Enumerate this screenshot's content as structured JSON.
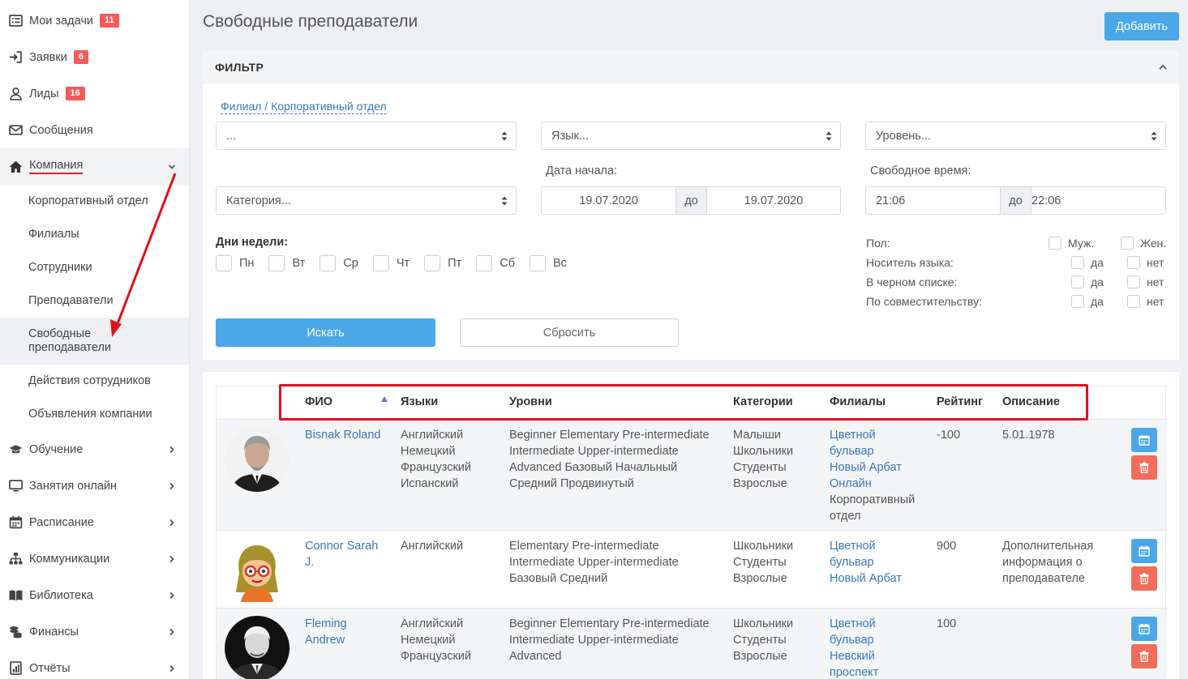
{
  "sidebar": {
    "items": [
      {
        "label": "Мои задачи",
        "badge": "11",
        "icon": "list-icon"
      },
      {
        "label": "Заявки",
        "badge": "6",
        "icon": "sign-in-icon"
      },
      {
        "label": "Лиды",
        "badge": "16",
        "icon": "user-icon"
      },
      {
        "label": "Сообщения",
        "badge": "",
        "icon": "envelope-icon"
      },
      {
        "label": "Компания",
        "badge": "",
        "icon": "home-icon"
      }
    ],
    "company_sub": [
      "Корпоративный отдел",
      "Филиалы",
      "Сотрудники",
      "Преподаватели",
      "Свободные преподаватели",
      "Действия сотрудников",
      "Объявления компании"
    ],
    "bottom_items": [
      {
        "label": "Обучение",
        "icon": "graduation-cap-icon"
      },
      {
        "label": "Занятия онлайн",
        "icon": "monitor-icon"
      },
      {
        "label": "Расписание",
        "icon": "calendar-icon"
      },
      {
        "label": "Коммуникации",
        "icon": "sitemap-icon"
      },
      {
        "label": "Библиотека",
        "icon": "book-icon"
      },
      {
        "label": "Финансы",
        "icon": "coins-icon"
      },
      {
        "label": "Отчёты",
        "icon": "report-icon"
      }
    ]
  },
  "page": {
    "title": "Свободные преподаватели",
    "add_label": "Добавить"
  },
  "filter": {
    "header": "ФИЛЬТР",
    "branch_link": "Филиал / Корпоративный отдел",
    "branch_value": "...",
    "language_placeholder": "Язык...",
    "level_placeholder": "Уровень...",
    "category_placeholder": "Категория...",
    "date_label": "Дата начала:",
    "date_from": "19.07.2020",
    "date_sep": "до",
    "date_to": "19.07.2020",
    "time_label": "Свободное время:",
    "time_from": "21:06",
    "time_sep": "до",
    "time_to": "22:06",
    "days_label": "Дни недели:",
    "days": [
      "Пн",
      "Вт",
      "Ср",
      "Чт",
      "Пт",
      "Сб",
      "Вс"
    ],
    "options": [
      {
        "label": "Пол:",
        "a": "Муж.",
        "b": "Жен."
      },
      {
        "label": "Носитель языка:",
        "a": "да",
        "b": "нет"
      },
      {
        "label": "В черном списке:",
        "a": "да",
        "b": "нет"
      },
      {
        "label": "По совместительству:",
        "a": "да",
        "b": "нет"
      }
    ],
    "search_label": "Искать",
    "reset_label": "Сбросить"
  },
  "table": {
    "headers": {
      "name": "ФИО",
      "languages": "Языки",
      "levels": "Уровни",
      "categories": "Категории",
      "branches": "Филиалы",
      "rating": "Рейтинг",
      "description": "Описание"
    },
    "rows": [
      {
        "name": [
          "Bisnak Roland"
        ],
        "languages": [
          "Английский",
          "Немецкий",
          "Французский",
          "Испанский"
        ],
        "levels": [
          "Beginner Elementary Pre-intermediate",
          "Intermediate Upper-intermediate",
          "Advanced Базовый Начальный",
          "Средний Продвинутый"
        ],
        "categories": [
          "Малыши",
          "Школьники",
          "Студенты",
          "Взрослые"
        ],
        "branches_links": [
          "Цветной",
          "бульвар",
          "Новый Арбат",
          "Онлайн"
        ],
        "branches_plain": [
          "Корпоративный",
          "отдел"
        ],
        "rating": "-100",
        "description": [
          "5.01.1978"
        ]
      },
      {
        "name": [
          "Connor Sarah",
          "J."
        ],
        "languages": [
          "Английский"
        ],
        "levels": [
          "Elementary Pre-intermediate",
          "Intermediate Upper-intermediate",
          "Базовый Средний"
        ],
        "categories": [
          "Школьники",
          "Студенты",
          "Взрослые"
        ],
        "branches_links": [
          "Цветной",
          "бульвар",
          "Новый Арбат"
        ],
        "branches_plain": [],
        "rating": "900",
        "description": [
          "Дополнительная",
          "информация о",
          "преподавателе"
        ]
      },
      {
        "name": [
          "Fleming",
          "Andrew"
        ],
        "languages": [
          "Английский",
          "Немецкий",
          "Французский"
        ],
        "levels": [
          "Beginner Elementary Pre-intermediate",
          "Intermediate Upper-intermediate",
          "Advanced"
        ],
        "categories": [
          "Школьники",
          "Студенты",
          "Взрослые"
        ],
        "branches_links": [
          "Цветной",
          "бульвар",
          "Невский",
          "проспект"
        ],
        "branches_plain": [],
        "rating": "100",
        "description": []
      }
    ]
  },
  "colors": {
    "accent": "#4aa8e8",
    "link": "#3c76b8",
    "danger": "#f26d5b",
    "badge": "#f45b5b",
    "annotation": "#e0101a"
  }
}
